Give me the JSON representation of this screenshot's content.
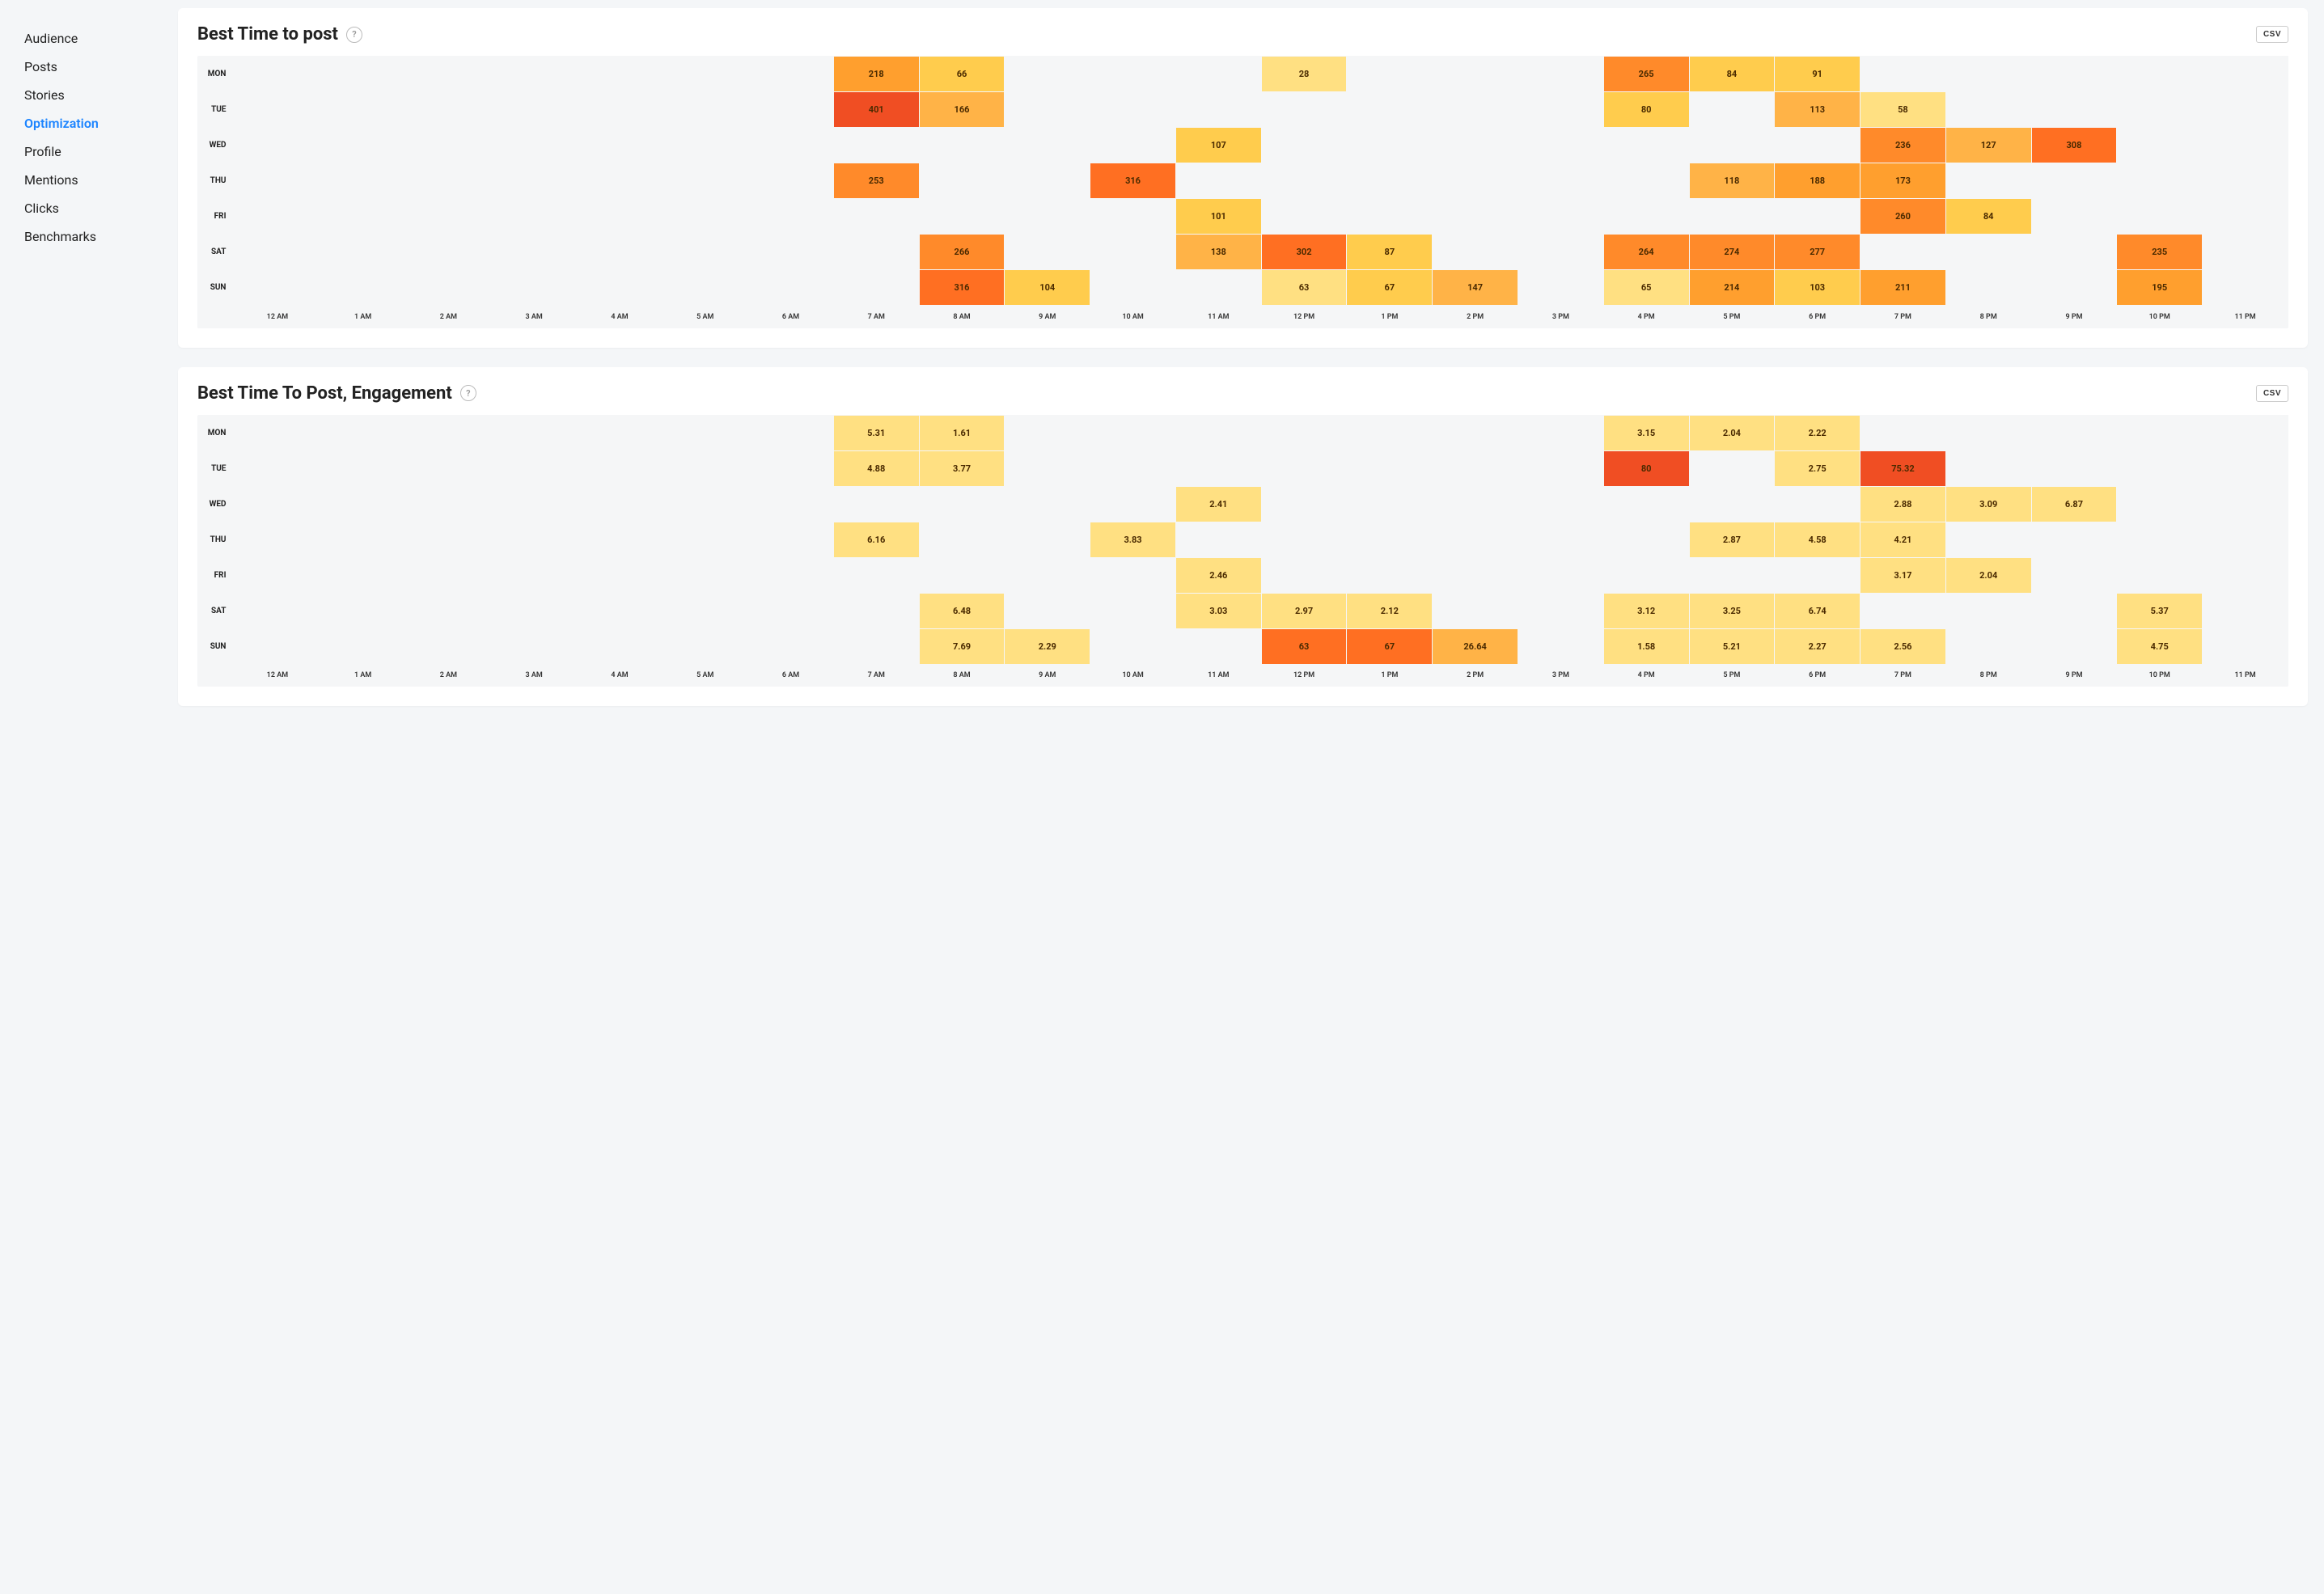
{
  "sidebar": {
    "items": [
      {
        "label": "Audience"
      },
      {
        "label": "Posts"
      },
      {
        "label": "Stories"
      },
      {
        "label": "Optimization",
        "active": true
      },
      {
        "label": "Profile"
      },
      {
        "label": "Mentions"
      },
      {
        "label": "Clicks"
      },
      {
        "label": "Benchmarks"
      }
    ]
  },
  "cards": [
    {
      "title": "Best Time to post",
      "csv": "CSV"
    },
    {
      "title": "Best Time To Post, Engagement",
      "csv": "CSV"
    }
  ],
  "chart_data": [
    {
      "type": "heatmap",
      "title": "Best Time to post",
      "x_labels": [
        "12 AM",
        "1 AM",
        "2 AM",
        "3 AM",
        "4 AM",
        "5 AM",
        "6 AM",
        "7 AM",
        "8 AM",
        "9 AM",
        "10 AM",
        "11 AM",
        "12 PM",
        "1 PM",
        "2 PM",
        "3 PM",
        "4 PM",
        "5 PM",
        "6 PM",
        "7 PM",
        "8 PM",
        "9 PM",
        "10 PM",
        "11 PM"
      ],
      "y_labels": [
        "MON",
        "TUE",
        "WED",
        "THU",
        "FRI",
        "SAT",
        "SUN"
      ],
      "grid": [
        [
          null,
          null,
          null,
          null,
          null,
          null,
          null,
          218,
          66,
          null,
          null,
          null,
          28,
          null,
          null,
          null,
          265,
          84,
          91,
          null,
          null,
          null,
          null,
          null
        ],
        [
          null,
          null,
          null,
          null,
          null,
          null,
          null,
          401,
          166,
          null,
          null,
          null,
          null,
          null,
          null,
          null,
          80,
          null,
          113,
          58,
          null,
          null,
          null,
          null
        ],
        [
          null,
          null,
          null,
          null,
          null,
          null,
          null,
          null,
          null,
          null,
          null,
          107,
          null,
          null,
          null,
          null,
          null,
          null,
          null,
          236,
          127,
          308,
          null,
          null
        ],
        [
          null,
          null,
          null,
          null,
          null,
          null,
          null,
          253,
          null,
          null,
          316,
          null,
          null,
          null,
          null,
          null,
          null,
          118,
          188,
          173,
          null,
          null,
          null,
          null
        ],
        [
          null,
          null,
          null,
          null,
          null,
          null,
          null,
          null,
          null,
          null,
          null,
          101,
          null,
          null,
          null,
          null,
          null,
          null,
          null,
          260,
          84,
          null,
          null,
          null
        ],
        [
          null,
          null,
          null,
          null,
          null,
          null,
          null,
          null,
          266,
          null,
          null,
          138,
          302,
          87,
          null,
          null,
          264,
          274,
          277,
          null,
          null,
          null,
          235,
          null
        ],
        [
          null,
          null,
          null,
          null,
          null,
          null,
          null,
          null,
          316,
          104,
          null,
          null,
          63,
          67,
          147,
          null,
          65,
          214,
          103,
          211,
          null,
          null,
          195,
          null
        ]
      ]
    },
    {
      "type": "heatmap",
      "title": "Best Time To Post, Engagement",
      "x_labels": [
        "12 AM",
        "1 AM",
        "2 AM",
        "3 AM",
        "4 AM",
        "5 AM",
        "6 AM",
        "7 AM",
        "8 AM",
        "9 AM",
        "10 AM",
        "11 AM",
        "12 PM",
        "1 PM",
        "2 PM",
        "3 PM",
        "4 PM",
        "5 PM",
        "6 PM",
        "7 PM",
        "8 PM",
        "9 PM",
        "10 PM",
        "11 PM"
      ],
      "y_labels": [
        "MON",
        "TUE",
        "WED",
        "THU",
        "FRI",
        "SAT",
        "SUN"
      ],
      "grid": [
        [
          null,
          null,
          null,
          null,
          null,
          null,
          null,
          5.31,
          1.61,
          null,
          null,
          null,
          null,
          null,
          null,
          null,
          3.15,
          2.04,
          2.22,
          null,
          null,
          null,
          null,
          null
        ],
        [
          null,
          null,
          null,
          null,
          null,
          null,
          null,
          4.88,
          3.77,
          null,
          null,
          null,
          null,
          null,
          null,
          null,
          80,
          null,
          2.75,
          75.32,
          null,
          null,
          null,
          null
        ],
        [
          null,
          null,
          null,
          null,
          null,
          null,
          null,
          null,
          null,
          null,
          null,
          2.41,
          null,
          null,
          null,
          null,
          null,
          null,
          null,
          2.88,
          3.09,
          6.87,
          null,
          null
        ],
        [
          null,
          null,
          null,
          null,
          null,
          null,
          null,
          6.16,
          null,
          null,
          3.83,
          null,
          null,
          null,
          null,
          null,
          null,
          2.87,
          4.58,
          4.21,
          null,
          null,
          null,
          null
        ],
        [
          null,
          null,
          null,
          null,
          null,
          null,
          null,
          null,
          null,
          null,
          null,
          2.46,
          null,
          null,
          null,
          null,
          null,
          null,
          null,
          3.17,
          2.04,
          null,
          null,
          null
        ],
        [
          null,
          null,
          null,
          null,
          null,
          null,
          null,
          null,
          6.48,
          null,
          null,
          3.03,
          2.97,
          2.12,
          null,
          null,
          3.12,
          3.25,
          6.74,
          null,
          null,
          null,
          5.37,
          null
        ],
        [
          null,
          null,
          null,
          null,
          null,
          null,
          null,
          null,
          7.69,
          2.29,
          null,
          null,
          63,
          67,
          26.64,
          null,
          1.58,
          5.21,
          2.27,
          2.56,
          null,
          null,
          4.75,
          null
        ]
      ]
    }
  ]
}
